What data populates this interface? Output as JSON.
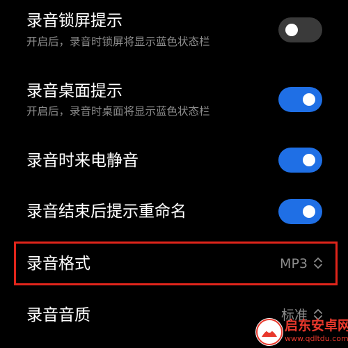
{
  "settings": {
    "lock_screen": {
      "title": "录音锁屏提示",
      "subtitle": "开启后，录音时锁屏将显示蓝色状态栏",
      "enabled": false
    },
    "desktop": {
      "title": "录音桌面提示",
      "subtitle": "开启后，录音时桌面将显示蓝色状态栏",
      "enabled": true
    },
    "call_mute": {
      "title": "录音时来电静音",
      "enabled": true
    },
    "rename_prompt": {
      "title": "录音结束后提示重命名",
      "enabled": true
    },
    "format": {
      "title": "录音格式",
      "value": "MP3"
    },
    "quality": {
      "title": "录音音质",
      "value": "标准"
    }
  },
  "colors": {
    "background": "#000000",
    "toggle_on": "#1f6fe5",
    "toggle_off": "#3a3a3a",
    "highlight_border": "#e0251b",
    "watermark": "#e8382c"
  },
  "icons": {
    "selector": "chevron-up-down-icon",
    "watermark_logo": "watermark-logo-icon"
  },
  "watermark": {
    "name": "启东安卓网",
    "url": "www.qdltdu.com"
  }
}
